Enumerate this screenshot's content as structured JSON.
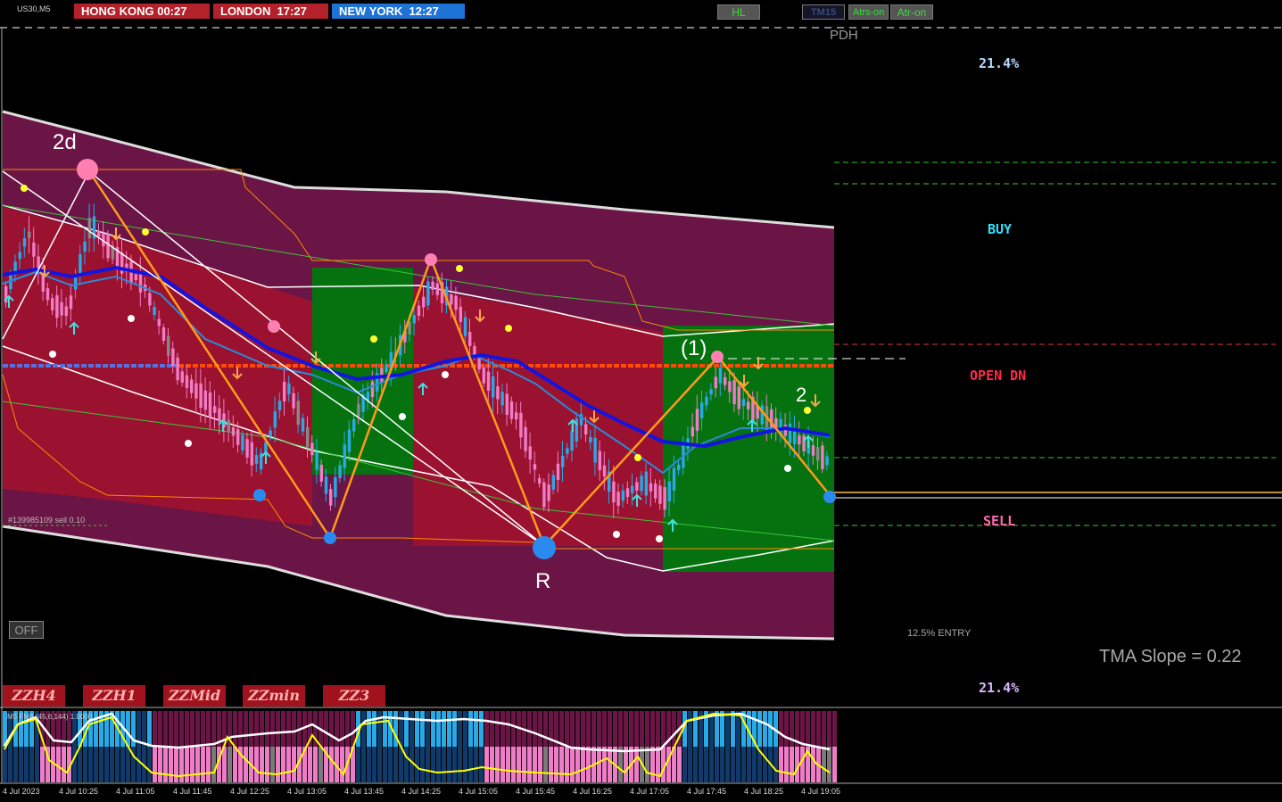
{
  "symbol": "US30,M5",
  "clocks": [
    {
      "label": "HONG KONG 00:27",
      "color": "#b3212a"
    },
    {
      "label": "LONDON  17:27",
      "color": "#b3212a"
    },
    {
      "label": "NEW YORK  12:27",
      "color": "#1e73d6"
    }
  ],
  "toolbar": {
    "hl": "HL",
    "tm15": "TM15",
    "atrs_on": "Atrs-on",
    "atr_on": "Atr-on"
  },
  "levels": {
    "pdh": "PDH",
    "top_pct": "21.4%",
    "buy": "BUY",
    "open_dn": "OPEN DN",
    "sell": "SELL",
    "entry": "12.5% ENTRY",
    "bottom_pct": "21.4%"
  },
  "tma_slope": "TMA Slope = 0.22",
  "chart_labels": {
    "wave_2d": "2d",
    "wave_r": "R",
    "wave_1": "(1)",
    "wave_2": "2"
  },
  "order_label": "#139985109 sell 0.10",
  "off_button": "OFF",
  "zz_buttons": [
    "ZZH4",
    "ZZH1",
    "ZZMid",
    "ZZmin",
    "ZZ3"
  ],
  "sub_indicator": "M5 FMA (45,6,144) 1.0000",
  "x_ticks": [
    "4 Jul 2023",
    "4 Jul 10:25",
    "4 Jul 11:05",
    "4 Jul 11:45",
    "4 Jul 12:25",
    "4 Jul 13:05",
    "4 Jul 13:45",
    "4 Jul 14:25",
    "4 Jul 15:05",
    "4 Jul 15:45",
    "4 Jul 16:25",
    "4 Jul 17:05",
    "4 Jul 17:45",
    "4 Jul 18:25",
    "4 Jul 19:05"
  ],
  "colors": {
    "band": "#6b1446",
    "bear_zone": "#9b1230",
    "bull_zone": "#06720f",
    "bull_candle": "#29a9e6",
    "bear_candle": "#ee7cc6",
    "ma": "#1414e0",
    "zigzag": "#ff9a1a"
  }
}
